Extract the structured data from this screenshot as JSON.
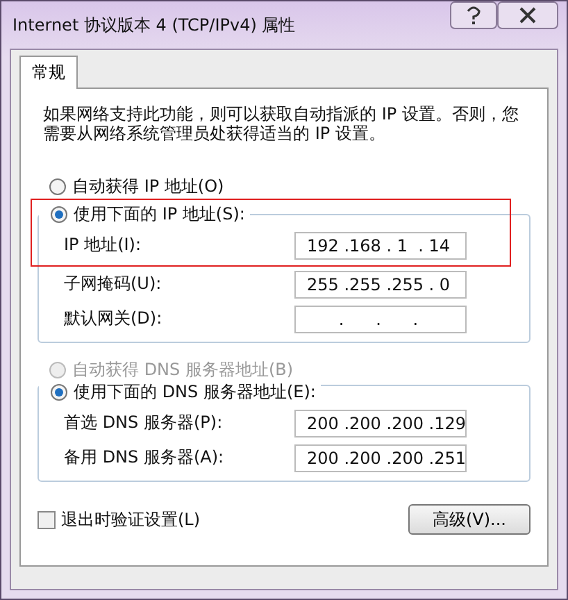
{
  "window": {
    "title": "Internet 协议版本 4 (TCP/IPv4) 属性"
  },
  "tabs": [
    {
      "label": "常规",
      "selected": true
    }
  ],
  "description": "如果网络支持此功能，则可以获取自动指派的 IP 设置。否则，您需要从网络系统管理员处获得适当的 IP 设置。",
  "ip_radios": [
    {
      "label": "自动获得 IP 地址(O)",
      "selected": false,
      "disabled": false
    },
    {
      "label": "使用下面的 IP 地址(S):",
      "selected": true,
      "disabled": false
    }
  ],
  "ip_fields": [
    {
      "label": "IP 地址(I):",
      "value": "192 .168 . 1  . 14"
    },
    {
      "label": "子网掩码(U):",
      "value": "255 .255 .255 . 0"
    },
    {
      "label": "默认网关(D):",
      "value": "      .      .      ."
    }
  ],
  "dns_radios": [
    {
      "label": "自动获得 DNS 服务器地址(B)",
      "selected": false,
      "disabled": true
    },
    {
      "label": "使用下面的 DNS 服务器地址(E):",
      "selected": true,
      "disabled": false
    }
  ],
  "dns_fields": [
    {
      "label": "首选 DNS 服务器(P):",
      "value": "200 .200 .200 .129"
    },
    {
      "label": "备用 DNS 服务器(A):",
      "value": "200 .200 .200 .251"
    }
  ],
  "validate_checkbox": {
    "label": "退出时验证设置(L)",
    "checked": false
  },
  "advanced_button": "高级(V)..."
}
